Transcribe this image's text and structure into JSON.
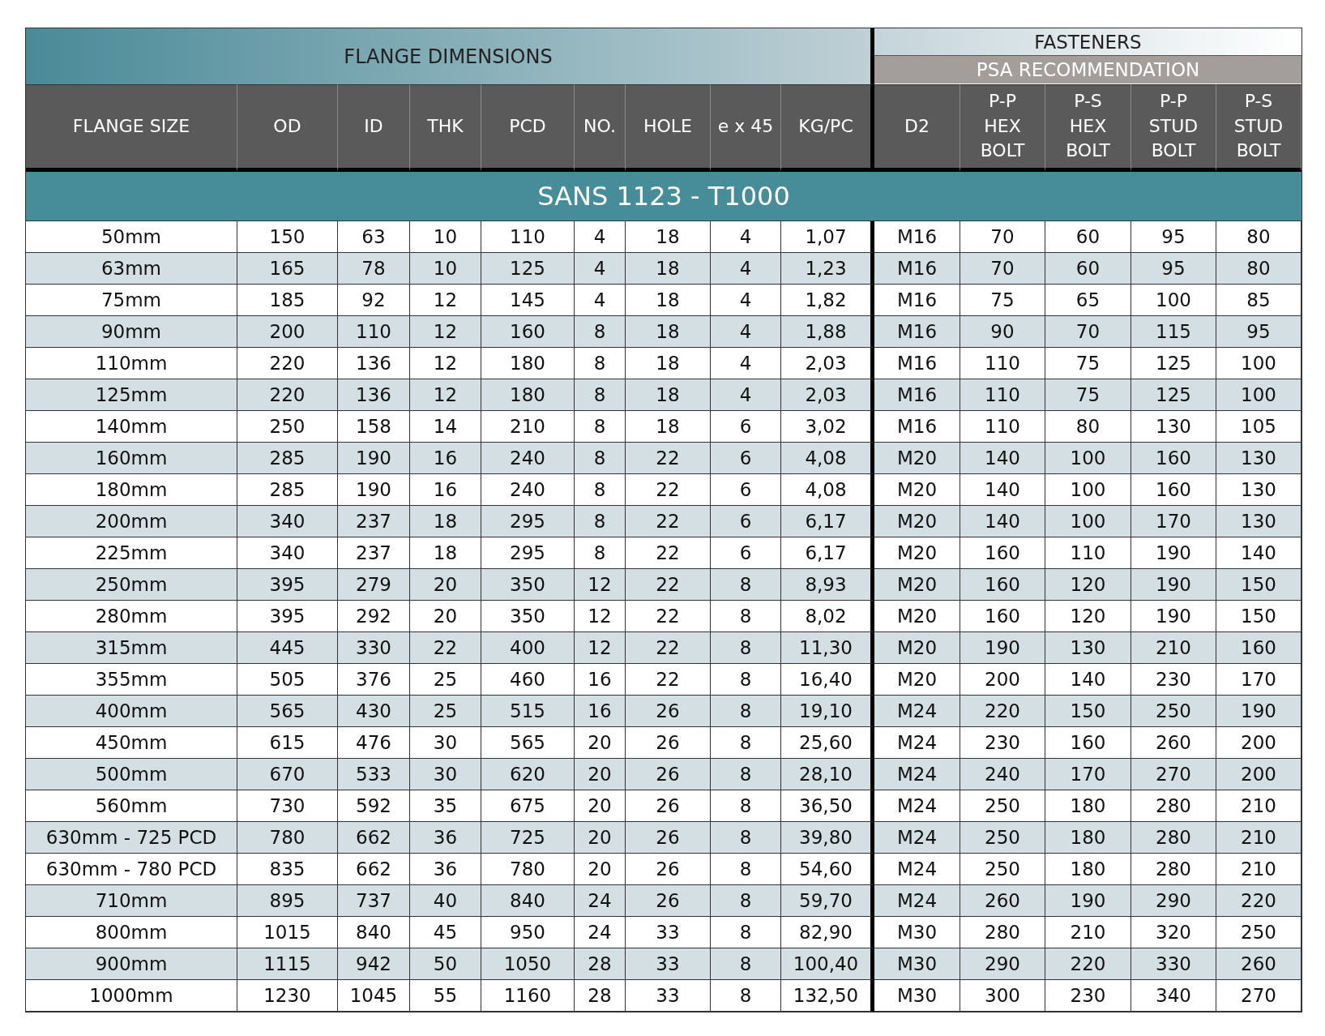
{
  "table": {
    "groups": [
      {
        "label": "FLANGE DIMENSIONS"
      },
      {
        "label": "FASTENERS",
        "sublabel": "PSA RECOMMENDATION"
      }
    ],
    "columns": [
      "FLANGE SIZE",
      "OD",
      "ID",
      "THK",
      "PCD",
      "NO.",
      "HOLE",
      "e x 45",
      "KG/PC",
      "D2",
      "P-P\nHEX\nBOLT",
      "P-S\nHEX\nBOLT",
      "P-P\nSTUD\nBOLT",
      "P-S\nSTUD\nBOLT"
    ],
    "section": "SANS 1123 - T1000",
    "rows": [
      [
        "50mm",
        "150",
        "63",
        "10",
        "110",
        "4",
        "18",
        "4",
        "1,07",
        "M16",
        "70",
        "60",
        "95",
        "80"
      ],
      [
        "63mm",
        "165",
        "78",
        "10",
        "125",
        "4",
        "18",
        "4",
        "1,23",
        "M16",
        "70",
        "60",
        "95",
        "80"
      ],
      [
        "75mm",
        "185",
        "92",
        "12",
        "145",
        "4",
        "18",
        "4",
        "1,82",
        "M16",
        "75",
        "65",
        "100",
        "85"
      ],
      [
        "90mm",
        "200",
        "110",
        "12",
        "160",
        "8",
        "18",
        "4",
        "1,88",
        "M16",
        "90",
        "70",
        "115",
        "95"
      ],
      [
        "110mm",
        "220",
        "136",
        "12",
        "180",
        "8",
        "18",
        "4",
        "2,03",
        "M16",
        "110",
        "75",
        "125",
        "100"
      ],
      [
        "125mm",
        "220",
        "136",
        "12",
        "180",
        "8",
        "18",
        "4",
        "2,03",
        "M16",
        "110",
        "75",
        "125",
        "100"
      ],
      [
        "140mm",
        "250",
        "158",
        "14",
        "210",
        "8",
        "18",
        "6",
        "3,02",
        "M16",
        "110",
        "80",
        "130",
        "105"
      ],
      [
        "160mm",
        "285",
        "190",
        "16",
        "240",
        "8",
        "22",
        "6",
        "4,08",
        "M20",
        "140",
        "100",
        "160",
        "130"
      ],
      [
        "180mm",
        "285",
        "190",
        "16",
        "240",
        "8",
        "22",
        "6",
        "4,08",
        "M20",
        "140",
        "100",
        "160",
        "130"
      ],
      [
        "200mm",
        "340",
        "237",
        "18",
        "295",
        "8",
        "22",
        "6",
        "6,17",
        "M20",
        "140",
        "100",
        "170",
        "130"
      ],
      [
        "225mm",
        "340",
        "237",
        "18",
        "295",
        "8",
        "22",
        "6",
        "6,17",
        "M20",
        "160",
        "110",
        "190",
        "140"
      ],
      [
        "250mm",
        "395",
        "279",
        "20",
        "350",
        "12",
        "22",
        "8",
        "8,93",
        "M20",
        "160",
        "120",
        "190",
        "150"
      ],
      [
        "280mm",
        "395",
        "292",
        "20",
        "350",
        "12",
        "22",
        "8",
        "8,02",
        "M20",
        "160",
        "120",
        "190",
        "150"
      ],
      [
        "315mm",
        "445",
        "330",
        "22",
        "400",
        "12",
        "22",
        "8",
        "11,30",
        "M20",
        "190",
        "130",
        "210",
        "160"
      ],
      [
        "355mm",
        "505",
        "376",
        "25",
        "460",
        "16",
        "22",
        "8",
        "16,40",
        "M20",
        "200",
        "140",
        "230",
        "170"
      ],
      [
        "400mm",
        "565",
        "430",
        "25",
        "515",
        "16",
        "26",
        "8",
        "19,10",
        "M24",
        "220",
        "150",
        "250",
        "190"
      ],
      [
        "450mm",
        "615",
        "476",
        "30",
        "565",
        "20",
        "26",
        "8",
        "25,60",
        "M24",
        "230",
        "160",
        "260",
        "200"
      ],
      [
        "500mm",
        "670",
        "533",
        "30",
        "620",
        "20",
        "26",
        "8",
        "28,10",
        "M24",
        "240",
        "170",
        "270",
        "200"
      ],
      [
        "560mm",
        "730",
        "592",
        "35",
        "675",
        "20",
        "26",
        "8",
        "36,50",
        "M24",
        "250",
        "180",
        "280",
        "210"
      ],
      [
        "630mm - 725 PCD",
        "780",
        "662",
        "36",
        "725",
        "20",
        "26",
        "8",
        "39,80",
        "M24",
        "250",
        "180",
        "280",
        "210"
      ],
      [
        "630mm - 780 PCD",
        "835",
        "662",
        "36",
        "780",
        "20",
        "26",
        "8",
        "54,60",
        "M24",
        "250",
        "180",
        "280",
        "210"
      ],
      [
        "710mm",
        "895",
        "737",
        "40",
        "840",
        "24",
        "26",
        "8",
        "59,70",
        "M24",
        "260",
        "190",
        "290",
        "220"
      ],
      [
        "800mm",
        "1015",
        "840",
        "45",
        "950",
        "24",
        "33",
        "8",
        "82,90",
        "M30",
        "280",
        "210",
        "320",
        "250"
      ],
      [
        "900mm",
        "1115",
        "942",
        "50",
        "1050",
        "28",
        "33",
        "8",
        "100,40",
        "M30",
        "290",
        "220",
        "330",
        "260"
      ],
      [
        "1000mm",
        "1230",
        "1045",
        "55",
        "1160",
        "28",
        "33",
        "8",
        "132,50",
        "M30",
        "300",
        "230",
        "340",
        "270"
      ]
    ]
  }
}
